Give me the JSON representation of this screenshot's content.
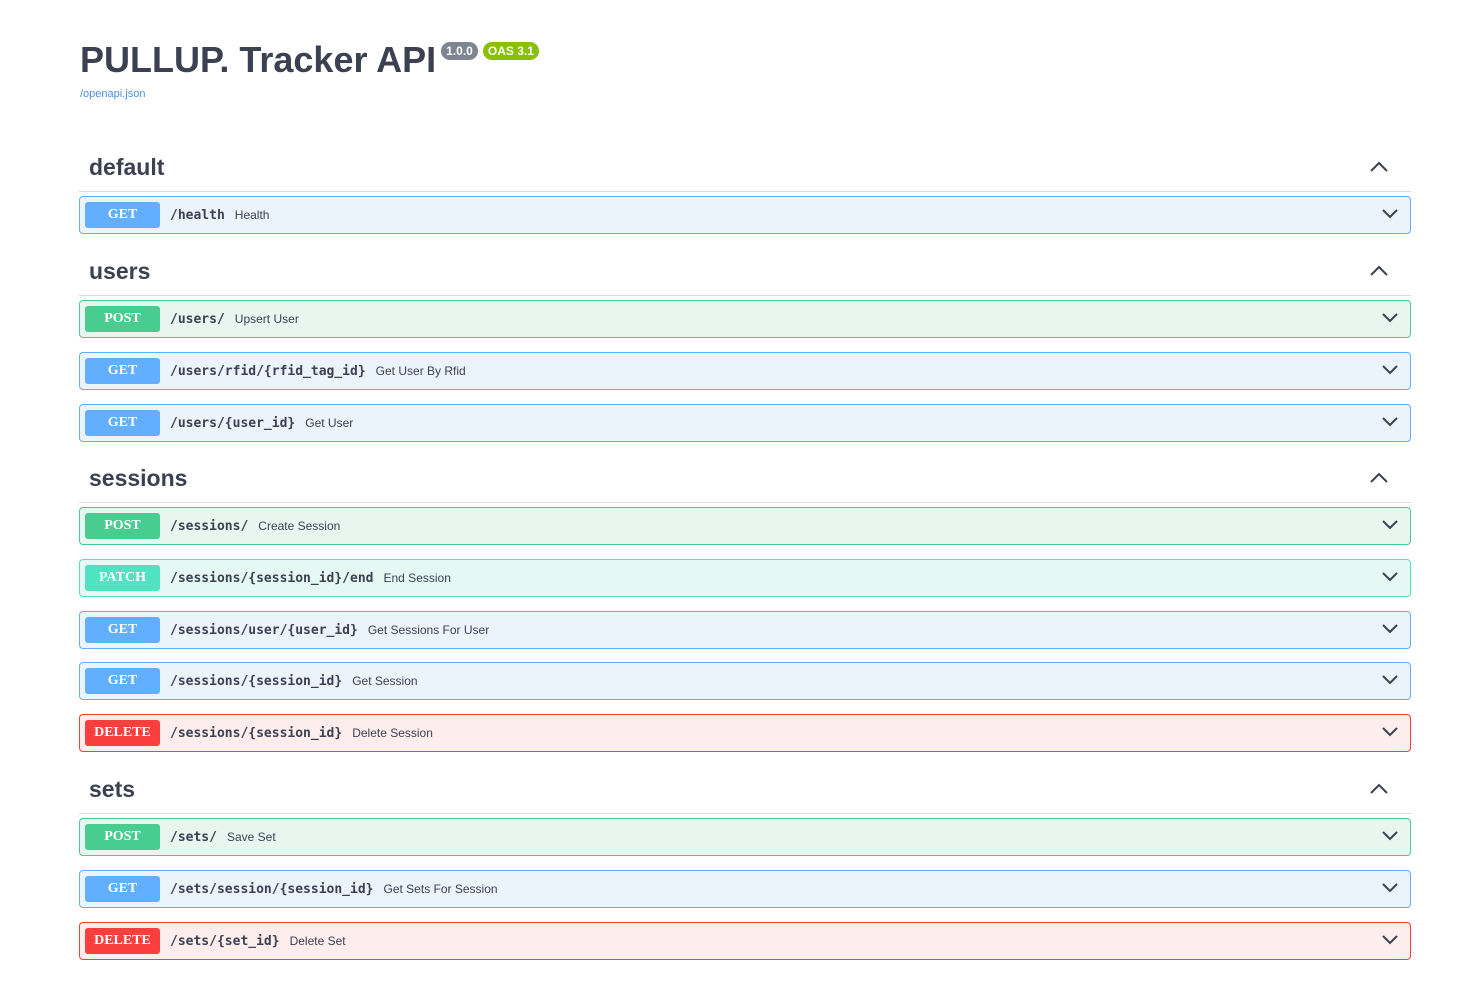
{
  "info": {
    "title": "PULLUP. Tracker API",
    "version": "1.0.0",
    "oas": "OAS 3.1",
    "spec_link": "/openapi.json"
  },
  "colors": {
    "get": "#61affe",
    "post": "#49cc90",
    "patch": "#50e3c2",
    "delete": "#f93e3e"
  },
  "tags": [
    {
      "name": "default",
      "operations": [
        {
          "method": "GET",
          "path": "/health",
          "summary": "Health"
        }
      ]
    },
    {
      "name": "users",
      "operations": [
        {
          "method": "POST",
          "path": "/users/",
          "summary": "Upsert User"
        },
        {
          "method": "GET",
          "path": "/users/rfid/{rfid_tag_id}",
          "summary": "Get User By Rfid"
        },
        {
          "method": "GET",
          "path": "/users/{user_id}",
          "summary": "Get User"
        }
      ]
    },
    {
      "name": "sessions",
      "operations": [
        {
          "method": "POST",
          "path": "/sessions/",
          "summary": "Create Session"
        },
        {
          "method": "PATCH",
          "path": "/sessions/{session_id}/end",
          "summary": "End Session"
        },
        {
          "method": "GET",
          "path": "/sessions/user/{user_id}",
          "summary": "Get Sessions For User"
        },
        {
          "method": "GET",
          "path": "/sessions/{session_id}",
          "summary": "Get Session"
        },
        {
          "method": "DELETE",
          "path": "/sessions/{session_id}",
          "summary": "Delete Session"
        }
      ]
    },
    {
      "name": "sets",
      "operations": [
        {
          "method": "POST",
          "path": "/sets/",
          "summary": "Save Set"
        },
        {
          "method": "GET",
          "path": "/sets/session/{session_id}",
          "summary": "Get Sets For Session"
        },
        {
          "method": "DELETE",
          "path": "/sets/{set_id}",
          "summary": "Delete Set"
        }
      ]
    }
  ]
}
